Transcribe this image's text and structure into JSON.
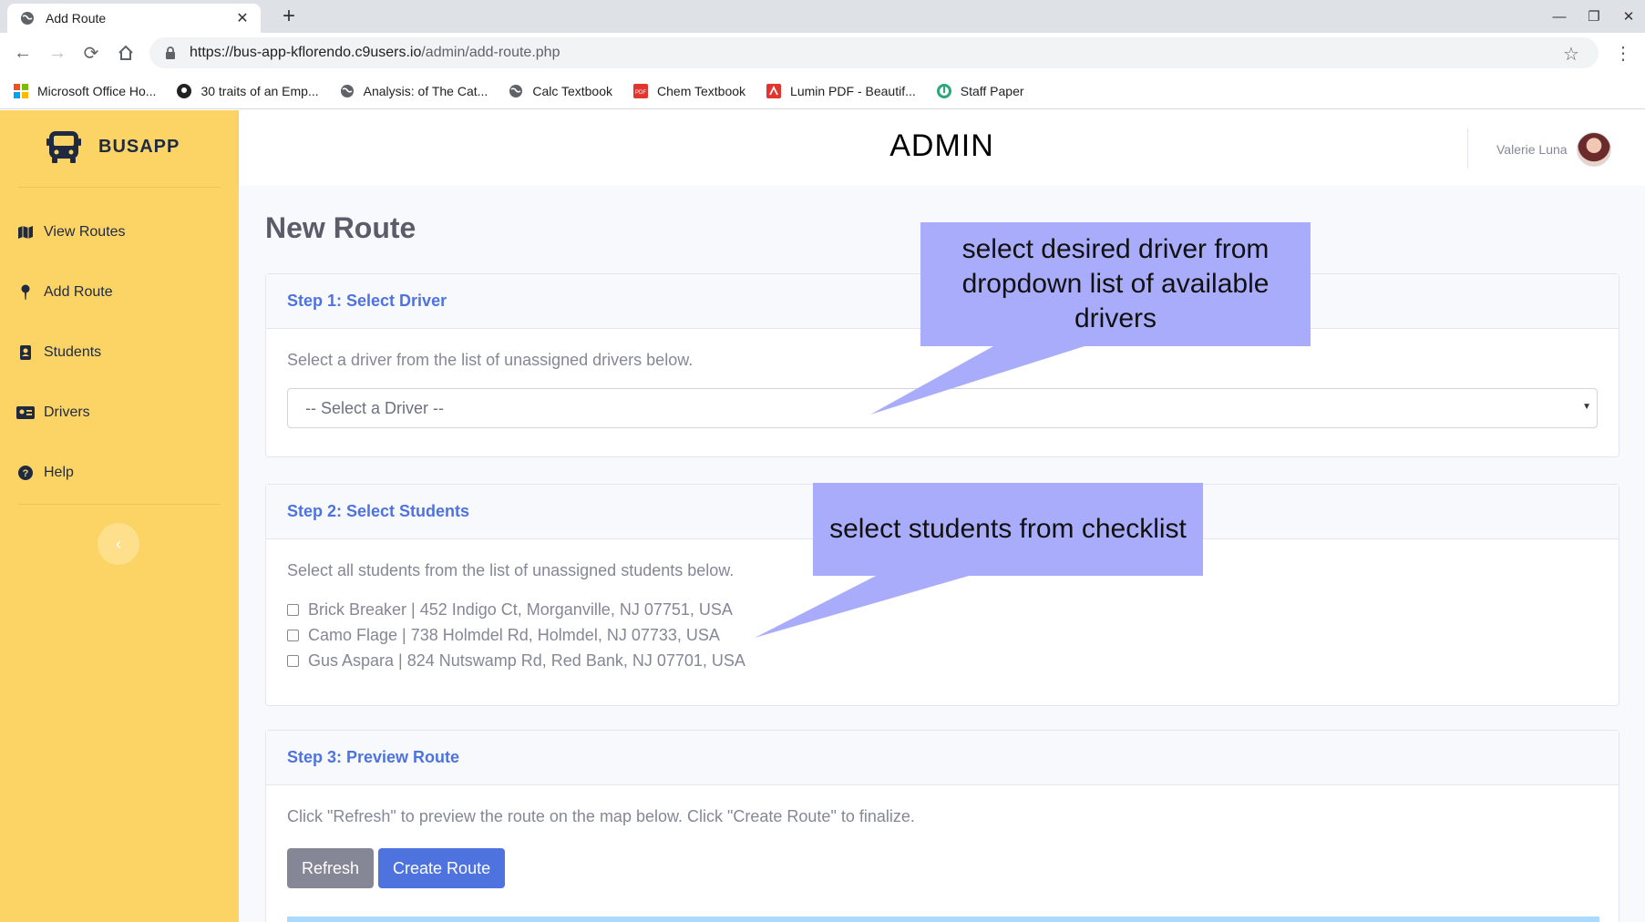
{
  "browser": {
    "tab_title": "Add Route",
    "url_host": "https://bus-app-kflorendo.c9users.io",
    "url_path": "/admin/add-route.php",
    "bookmarks": [
      {
        "label": "Microsoft Office Ho...",
        "icon": "microsoft-icon"
      },
      {
        "label": "30 traits of an Emp...",
        "icon": "site-icon"
      },
      {
        "label": "Analysis: of The Cat...",
        "icon": "globe-icon"
      },
      {
        "label": "Calc Textbook",
        "icon": "globe-icon"
      },
      {
        "label": "Chem Textbook",
        "icon": "pdf-icon"
      },
      {
        "label": "Lumin PDF - Beautif...",
        "icon": "lumin-icon"
      },
      {
        "label": "Staff Paper",
        "icon": "music-icon"
      }
    ]
  },
  "sidebar": {
    "brand": "BUSAPP",
    "items": [
      {
        "label": "View Routes",
        "icon": "map-icon"
      },
      {
        "label": "Add Route",
        "icon": "pin-icon"
      },
      {
        "label": "Students",
        "icon": "address-book-icon"
      },
      {
        "label": "Drivers",
        "icon": "id-card-icon"
      },
      {
        "label": "Help",
        "icon": "question-circle-icon"
      }
    ],
    "collapse_glyph": "‹"
  },
  "header": {
    "title": "ADMIN",
    "user_name": "Valerie Luna"
  },
  "page": {
    "title": "New Route",
    "step1": {
      "heading": "Step 1: Select Driver",
      "description": "Select a driver from the list of unassigned drivers below.",
      "select_value": "-- Select a Driver --"
    },
    "step2": {
      "heading": "Step 2: Select Students",
      "description": "Select all students from the list of unassigned students below.",
      "students": [
        "Brick Breaker | 452 Indigo Ct, Morganville, NJ 07751, USA",
        "Camo Flage | 738 Holmdel Rd, Holmdel, NJ 07733, USA",
        "Gus Aspara | 824 Nutswamp Rd, Red Bank, NJ 07701, USA"
      ]
    },
    "step3": {
      "heading": "Step 3: Preview Route",
      "description": "Click \"Refresh\" to preview the route on the map below. Click \"Create Route\" to finalize.",
      "refresh_label": "Refresh",
      "create_label": "Create Route"
    }
  },
  "annotations": {
    "driver_callout": "select desired driver from dropdown list of available drivers",
    "students_callout": "select students from checklist"
  },
  "colors": {
    "sidebar": "#fcd466",
    "primary": "#4e73df",
    "callout": "#a9acfb"
  }
}
